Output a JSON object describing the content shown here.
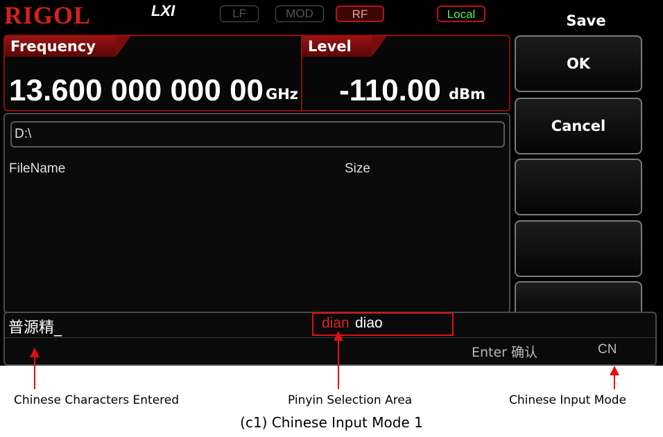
{
  "status_bar": {
    "logo": "RIGOL",
    "lxi": "LXI",
    "indicators": {
      "lf": "LF",
      "mod": "MOD",
      "rf": "RF",
      "local": "Local"
    }
  },
  "frequency": {
    "label": "Frequency",
    "value": "13.600 000 000 00",
    "unit": "GHz"
  },
  "level": {
    "label": "Level",
    "value": "-110.00",
    "unit": "dBm"
  },
  "file_browser": {
    "path": "D:\\",
    "columns": {
      "name": "FileName",
      "size": "Size"
    }
  },
  "input": {
    "typed": "普源精_",
    "pinyin_active": "dian",
    "pinyin_other": "diao",
    "enter_hint": "Enter 确认",
    "mode": "CN"
  },
  "softkeys": {
    "title": "Save",
    "ok": "OK",
    "cancel": "Cancel"
  },
  "annotations": {
    "chars_entered": "Chinese Characters Entered",
    "pinyin_area": "Pinyin Selection Area",
    "input_mode": "Chinese Input Mode",
    "caption": "(c1) Chinese Input Mode 1"
  }
}
